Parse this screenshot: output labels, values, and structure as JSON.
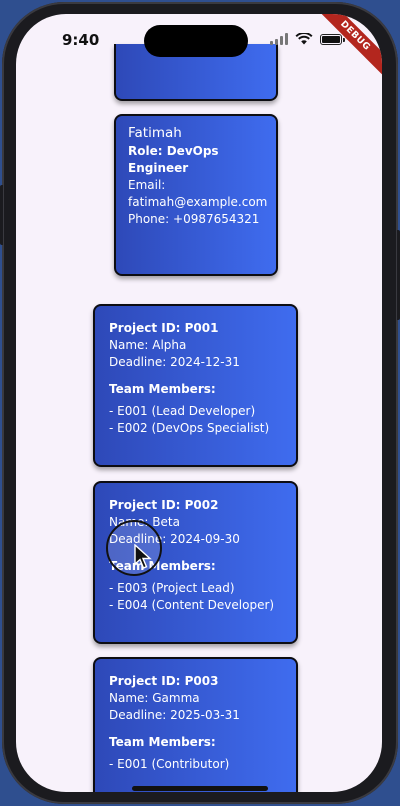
{
  "status_bar": {
    "time": "9:40"
  },
  "debug_banner": "DEBUG",
  "employees": [
    {
      "name": "",
      "role": "",
      "email_label": "",
      "email": "",
      "phone": ""
    },
    {
      "name": "Fatimah",
      "role": "Role: DevOps Engineer",
      "email_label": "Email:",
      "email": "fatimah@example.com",
      "phone": "Phone: +0987654321"
    }
  ],
  "projects": [
    {
      "id": "Project ID: P001",
      "name": "Name: Alpha",
      "deadline": "Deadline: 2024-12-31",
      "team_title": "Team Members:",
      "members": [
        "- E001 (Lead Developer)",
        "- E002 (DevOps Specialist)"
      ]
    },
    {
      "id": "Project ID: P002",
      "name": "Name: Beta",
      "deadline": "Deadline: 2024-09-30",
      "team_title": "Team Members:",
      "members": [
        "- E003 (Project Lead)",
        "- E004 (Content Developer)"
      ]
    },
    {
      "id": "Project ID: P003",
      "name": "Name: Gamma",
      "deadline": "Deadline: 2025-03-31",
      "team_title": "Team Members:",
      "members": [
        "- E001 (Contributor)"
      ]
    }
  ]
}
